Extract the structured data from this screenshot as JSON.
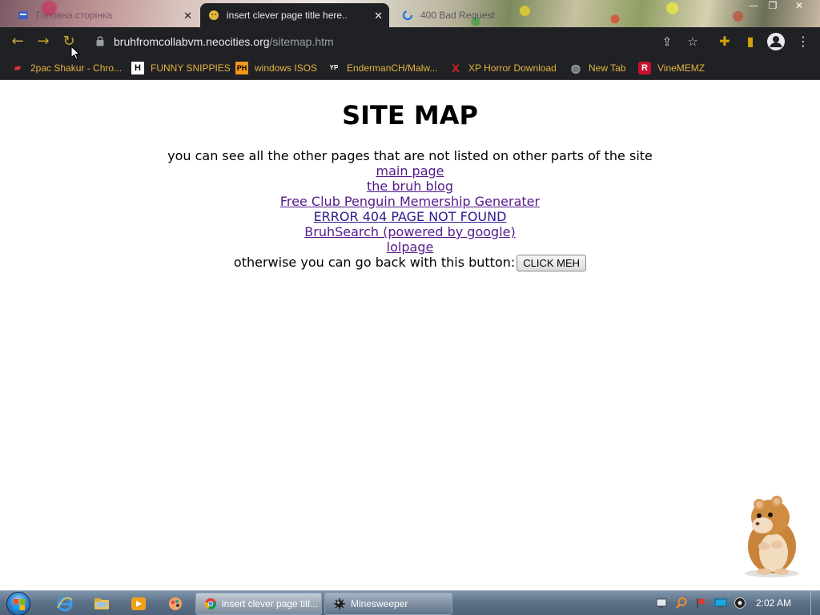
{
  "tabs": [
    {
      "label": "Головна сторінка",
      "icon": "site-icon"
    },
    {
      "label": "insert clever page title here..",
      "icon": "neocities-icon"
    },
    {
      "label": "400 Bad Request",
      "icon": "loading-icon"
    }
  ],
  "window_controls": {
    "minimize": "—",
    "maximize": "❐",
    "close": "✕"
  },
  "toolbar": {
    "url_host": "bruhfromcollabvm.neocities.org",
    "url_path": "/sitemap.htm"
  },
  "bookmarks": [
    {
      "label": "2pac Shakur - Chro...",
      "icon": "flag-icon",
      "glyph": "▰"
    },
    {
      "label": "FUNNY SNIPPIES",
      "icon": "h-icon",
      "glyph": "H"
    },
    {
      "label": "windows ISOS",
      "icon": "ph-icon",
      "glyph": "PH"
    },
    {
      "label": "EndermanCH/Malw...",
      "icon": "yp-icon",
      "glyph": "YP"
    },
    {
      "label": "XP Horror Download",
      "icon": "x-icon",
      "glyph": "X"
    },
    {
      "label": "New Tab",
      "icon": "globe-icon",
      "glyph": "◍"
    },
    {
      "label": "VineMEMZ",
      "icon": "r-icon",
      "glyph": "R"
    }
  ],
  "page": {
    "title": "SITE MAP",
    "intro": "you can see all the other pages that are not listed on other parts of the site",
    "links": [
      "main page",
      "the bruh blog",
      "Free Club Penguin Memership Generater",
      "ERROR 404 PAGE NOT FOUND",
      "BruhSearch (powered by google)",
      "lolpage"
    ],
    "back_text": "otherwise you can go back with this button:",
    "back_button": "CLICK MEH"
  },
  "taskbar": {
    "tasks": [
      {
        "label": "insert clever page titl...",
        "icon": "chrome-icon"
      },
      {
        "label": "Minesweeper",
        "icon": "mine-icon"
      }
    ],
    "clock": "2:02 AM"
  },
  "colors": {
    "chrome_dark": "#202124",
    "bookmark_text": "#e3b341",
    "visited_link": "#551a8b",
    "link": "#2a1d8f"
  }
}
